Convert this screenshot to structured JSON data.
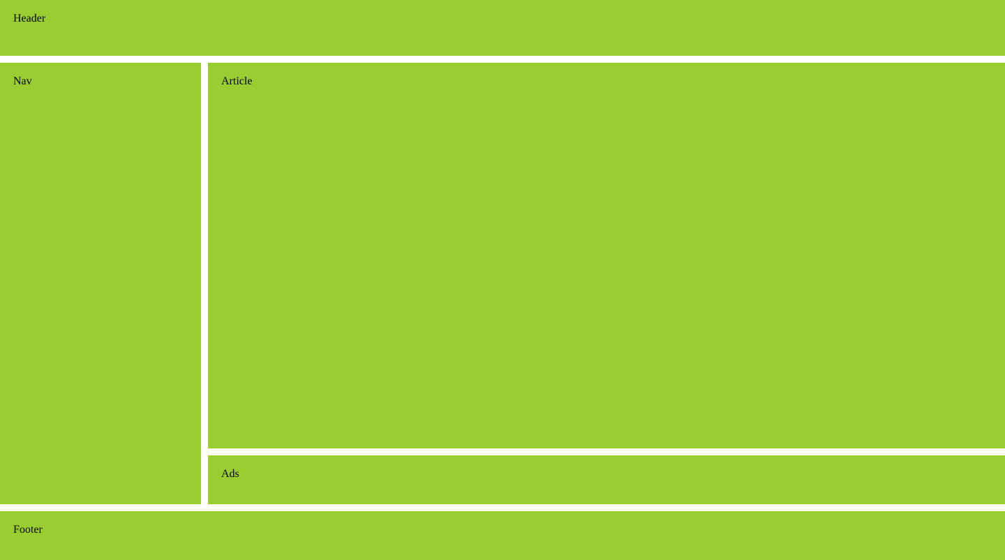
{
  "header": {
    "label": "Header"
  },
  "nav": {
    "label": "Nav"
  },
  "article": {
    "label": "Article"
  },
  "ads": {
    "label": "Ads"
  },
  "footer": {
    "label": "Footer"
  },
  "colors": {
    "region_background": "#9acd32",
    "page_background": "#ffffff",
    "text": "#000000"
  }
}
